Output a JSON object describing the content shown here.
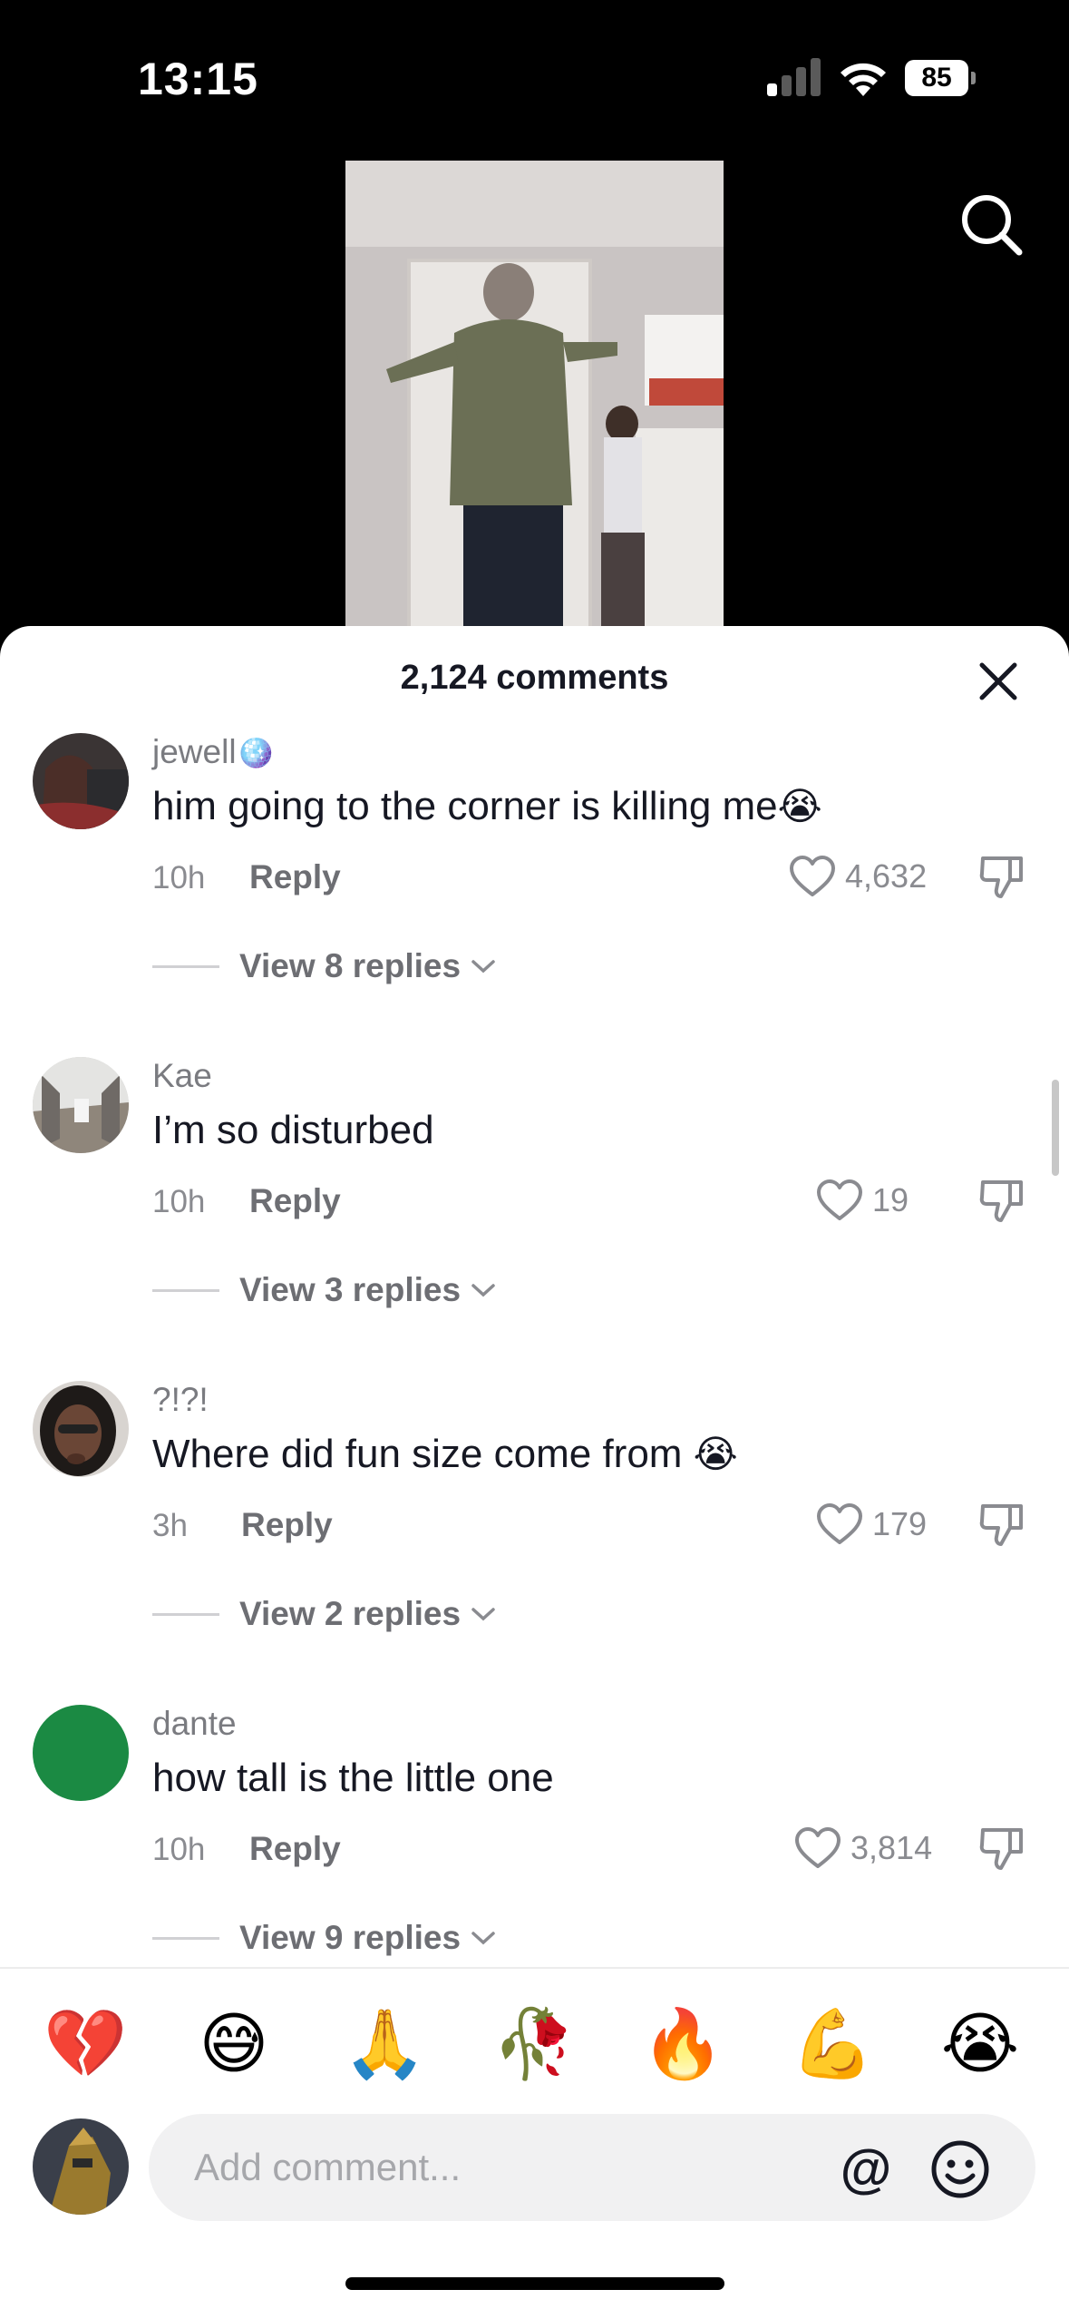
{
  "status_bar": {
    "time": "13:15",
    "battery": "85"
  },
  "sheet": {
    "title": "2,124 comments"
  },
  "comments": [
    {
      "username": "jewell",
      "username_emoji": "🪩",
      "text": "him going to the corner is killing me",
      "text_emoji": "😭",
      "time": "10h",
      "reply_label": "Reply",
      "likes": "4,632",
      "view_replies": "View 8 replies"
    },
    {
      "username": "Kae",
      "username_emoji": "",
      "text": "I’m so disturbed",
      "text_emoji": "",
      "time": "10h",
      "reply_label": "Reply",
      "likes": "19",
      "view_replies": "View 3 replies"
    },
    {
      "username": "?!?!",
      "username_emoji": "",
      "text": "Where did fun size come from ",
      "text_emoji": "😭",
      "time": "3h",
      "reply_label": "Reply",
      "likes": "179",
      "view_replies": "View 2 replies"
    },
    {
      "username": "dante",
      "username_emoji": "",
      "text": "how tall is the little one",
      "text_emoji": "",
      "time": "10h",
      "reply_label": "Reply",
      "likes": "3,814",
      "view_replies": "View 9 replies"
    }
  ],
  "quick_emojis": [
    "💔",
    "😅",
    "🙏",
    "🥀",
    "🔥",
    "💪",
    "😭"
  ],
  "composer": {
    "placeholder": "Add comment...",
    "at_symbol": "@"
  },
  "colors": {
    "text_primary": "#161823",
    "text_secondary": "#8a8b90",
    "dante_avatar": "#1b8a43"
  }
}
